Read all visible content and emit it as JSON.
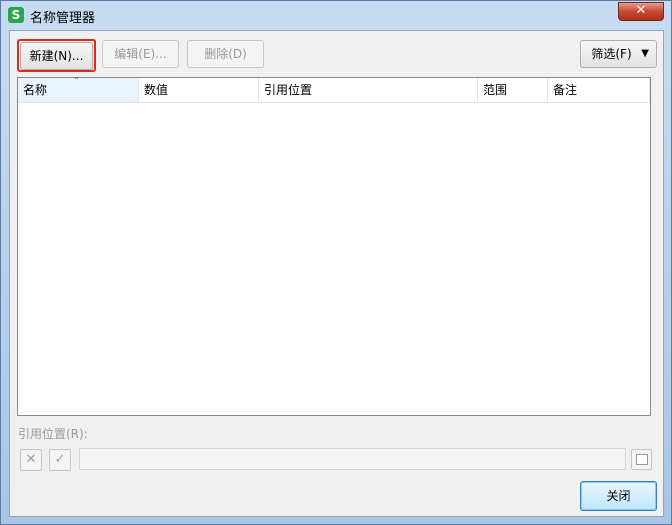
{
  "window": {
    "title": "名称管理器",
    "app_icon_letter": "S",
    "close_glyph": "✕"
  },
  "toolbar": {
    "new_label": "新建(N)...",
    "edit_label": "编辑(E)...",
    "delete_label": "删除(D)",
    "filter_label": "筛选(F)",
    "filter_arrow": "▼"
  },
  "list": {
    "columns": [
      "名称",
      "数值",
      "引用位置",
      "范围",
      "备注"
    ],
    "sort_indicator": "ˆ",
    "rows": []
  },
  "reference": {
    "label": "引用位置(R):",
    "cancel_glyph": "✕",
    "confirm_glyph": "✓",
    "value": ""
  },
  "footer": {
    "close_label": "关闭"
  },
  "colors": {
    "highlight_outline": "#e0281b",
    "title_icon": "#2aa64a"
  }
}
